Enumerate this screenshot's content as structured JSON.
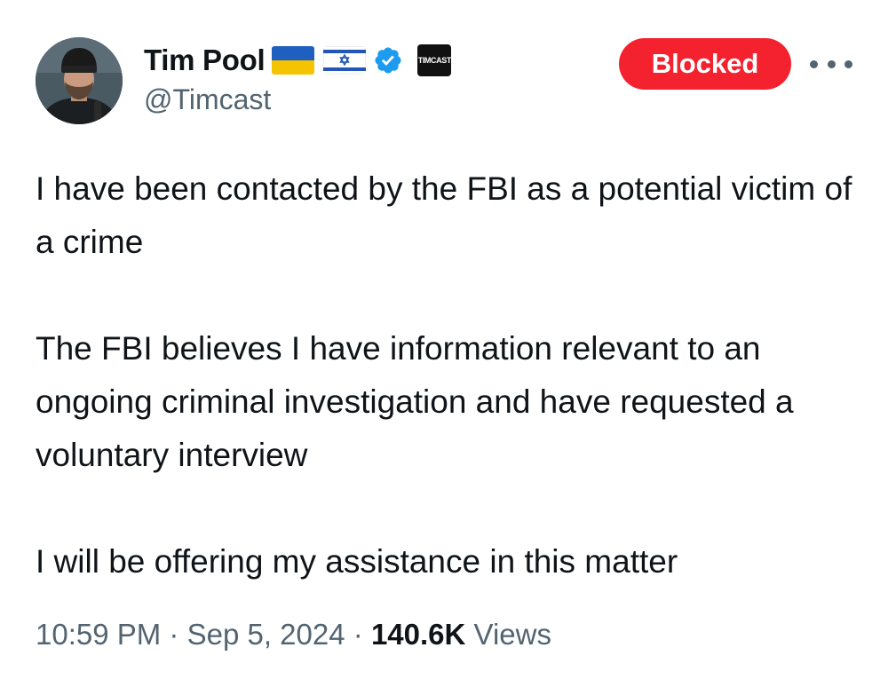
{
  "author": {
    "display_name": "Tim Pool",
    "handle": "@Timcast",
    "badges": [
      "ukraine-flag-icon",
      "israel-flag-icon",
      "verified-badge-icon",
      "affiliate-badge-icon"
    ],
    "affiliate_label": "TIMCAST"
  },
  "actions": {
    "blocked_label": "Blocked",
    "more_icon": "more-horizontal-icon"
  },
  "tweet": {
    "paragraphs": [
      "I have been contacted by the FBI as a potential victim of a crime",
      "The FBI believes I have information relevant to an ongoing criminal investigation and have requested a voluntary interview",
      "I will be offering my assistance in this matter"
    ]
  },
  "meta": {
    "time": "10:59 PM",
    "separator": "·",
    "date": "Sep 5, 2024",
    "views_count": "140.6K",
    "views_label": "Views"
  },
  "colors": {
    "blocked_red": "#f4212e",
    "verified_blue": "#1d9bf0",
    "secondary_text": "#536471",
    "primary_text": "#0f1419"
  }
}
